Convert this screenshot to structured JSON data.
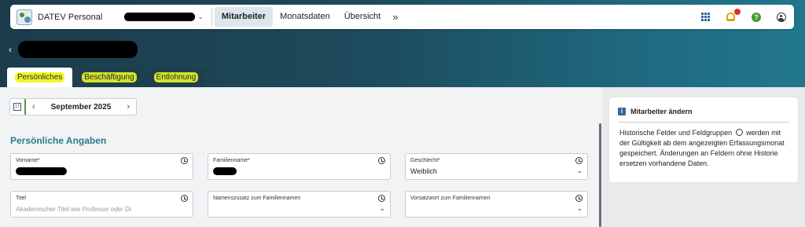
{
  "app": {
    "title": "DATEV Personal"
  },
  "nav": {
    "items": [
      {
        "label": "Mitarbeiter",
        "active": true
      },
      {
        "label": "Monatsdaten",
        "active": false
      },
      {
        "label": "Übersicht",
        "active": false
      }
    ],
    "more_icon": "»"
  },
  "header": {
    "back_icon": "‹"
  },
  "tabs": [
    {
      "label": "Persönliches",
      "active": true
    },
    {
      "label": "Beschäftigung",
      "active": false
    },
    {
      "label": "Entlohnung",
      "active": false
    }
  ],
  "period": {
    "month": "September 2025",
    "prev": "‹",
    "next": "›"
  },
  "section": {
    "title": "Persönliche Angaben"
  },
  "fields": {
    "vorname": {
      "label": "Vorname*"
    },
    "familienname": {
      "label": "Familienname*"
    },
    "geschlecht": {
      "label": "Geschlecht*",
      "value": "Weiblich"
    },
    "titel": {
      "label": "Titel",
      "placeholder": "Akademischer Titel wie Professor oder Dr."
    },
    "namenszusatz": {
      "label": "Namenszusatz zum Familiennamen"
    },
    "vorsatzwort": {
      "label": "Vorsatzwort zum Familiennamen"
    }
  },
  "info": {
    "title": "Mitarbeiter ändern",
    "icon": "i",
    "text_1": "Historische Felder und Feldgruppen",
    "text_2": "werden mit der Gültigkeit ab dem angezeigten Erfassungsmonat gespeichert. Änderungen an Feldern ohne Historie ersetzen vorhandene Daten."
  },
  "icons": {
    "apps": "grid-icon",
    "notifications": "bell-icon",
    "help": "help-icon",
    "user": "user-icon",
    "history": "history-icon"
  },
  "colors": {
    "accent": "#2a7d8b",
    "highlight": "#f3f52c",
    "hero": "#1d4a5c",
    "help": "#4a9a2a"
  }
}
